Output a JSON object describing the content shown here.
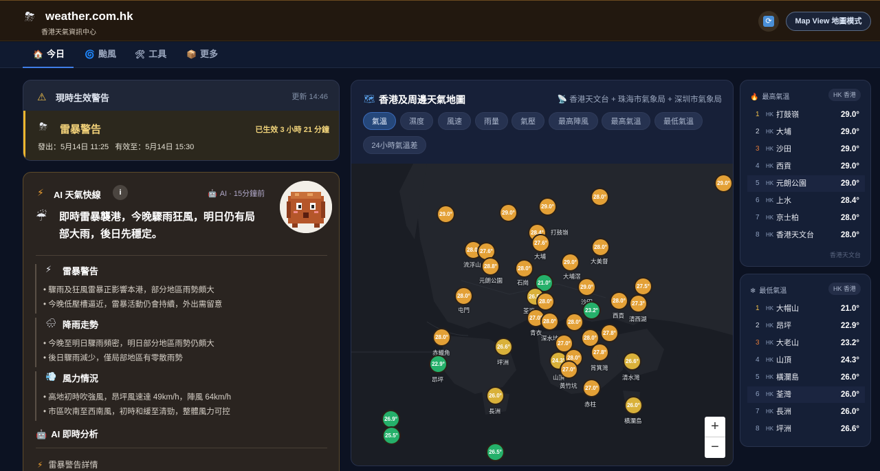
{
  "header": {
    "logo_icon": "⛈",
    "title": "weather.com.hk",
    "subtitle": "香港天氣資訊中心",
    "refresh_icon": "⟳",
    "map_view_label": "Map View 地圖模式"
  },
  "nav": {
    "tabs": [
      {
        "icon": "🏠",
        "label": "今日",
        "active": true
      },
      {
        "icon": "🌀",
        "label": "颱風",
        "active": false
      },
      {
        "icon": "🛠",
        "label": "工具",
        "active": false
      },
      {
        "icon": "📦",
        "label": "更多",
        "active": false
      }
    ]
  },
  "warnings": {
    "icon": "⚠",
    "title": "現時生效警告",
    "updated": "更新 14:46",
    "item": {
      "icon": "⛈",
      "title": "雷暴警告",
      "elapsed": "已生效 3 小時 21 分鐘",
      "issued": "發出：5月14日 11:25",
      "valid_until": "有效至：5月14日 15:30"
    }
  },
  "ai": {
    "icon": "⚡",
    "title": "AI 天氣快線",
    "info_icon": "i",
    "meta_icon": "🤖",
    "meta": "AI · 15分鐘前",
    "headline_icon": "☔",
    "headline": "即時雷暴襲港，今晚驟雨狂風，明日仍有局部大雨，後日先穩定。",
    "sections": [
      {
        "icon": "⚡",
        "title": "雷暴警告",
        "lines": [
          "• 驟雨及狂風雷暴正影響本港，部分地區雨勢頗大",
          "• 今晚低壓槽逼近，雷暴活動仍會持續，外出需留意"
        ]
      },
      {
        "icon": "🌧",
        "title": "降雨走勢",
        "lines": [
          "• 今晚至明日驟雨頻密，明日部分地區雨勢仍頗大",
          "• 後日驟雨減少，僅局部地區有零散雨勢"
        ]
      },
      {
        "icon": "💨",
        "title": "風力情況",
        "lines": [
          "• 高地初時吹強風，昂坪風速達 49km/h，陣風 64km/h",
          "• 市區吹南至西南風，初時和緩至清勁，整體風力可控"
        ]
      }
    ],
    "now_icon": "🤖",
    "now_title": "AI 即時分析",
    "detail_icon": "⚡",
    "detail_title": "雷暴警告詳情"
  },
  "map": {
    "title_icon": "🗺",
    "title": "香港及周邊天氣地圖",
    "sources_icon": "📡",
    "sources": "香港天文台 + 珠海市氣象局 + 深圳市氣象局",
    "chips": [
      "氣溫",
      "濕度",
      "風速",
      "雨量",
      "氣壓",
      "最高陣風",
      "最高氣溫",
      "最低氣溫",
      "24小時氣溫差"
    ],
    "active_chip": "氣溫",
    "zoom_in": "+",
    "zoom_out": "−",
    "markers": [
      {
        "label": "29.0°",
        "color": "or"
      },
      {
        "label": "29.0°",
        "color": "or"
      },
      {
        "label": "29.0°",
        "color": "or"
      },
      {
        "label": "29.0°",
        "color": "or"
      },
      {
        "label": "28.0°",
        "color": "or"
      },
      {
        "label": "28.4°",
        "color": "or"
      },
      {
        "label": "27.6°",
        "color": "or"
      },
      {
        "label": "28.0°",
        "color": "or"
      },
      {
        "label": "27.6°",
        "color": "or"
      },
      {
        "label": "28.8°",
        "color": "or"
      },
      {
        "label": "28.0°",
        "color": "or"
      },
      {
        "label": "29.0°",
        "color": "or"
      },
      {
        "label": "28.0°",
        "color": "or"
      },
      {
        "label": "21.0°",
        "color": "gr"
      },
      {
        "label": "29.0°",
        "color": "or"
      },
      {
        "label": "27.5°",
        "color": "or"
      },
      {
        "label": "28.0°",
        "color": "or"
      },
      {
        "label": "26.5°",
        "color": "yl"
      },
      {
        "label": "28.0°",
        "color": "or"
      },
      {
        "label": "23.2°",
        "color": "gr"
      },
      {
        "label": "28.0°",
        "color": "or"
      },
      {
        "label": "27.3°",
        "color": "or"
      },
      {
        "label": "27.0°",
        "color": "or"
      },
      {
        "label": "28.0°",
        "color": "or"
      },
      {
        "label": "28.0°",
        "color": "or"
      },
      {
        "label": "27.8°",
        "color": "or"
      },
      {
        "label": "28.0°",
        "color": "or"
      },
      {
        "label": "28.0°",
        "color": "or"
      },
      {
        "label": "26.6°",
        "color": "yl"
      },
      {
        "label": "22.9°",
        "color": "gr"
      },
      {
        "label": "27.8°",
        "color": "or"
      },
      {
        "label": "24.3°",
        "color": "yl"
      },
      {
        "label": "28.0°",
        "color": "or"
      },
      {
        "label": "27.0°",
        "color": "or"
      },
      {
        "label": "27.0°",
        "color": "or"
      },
      {
        "label": "26.6°",
        "color": "yl"
      },
      {
        "label": "27.0°",
        "color": "or"
      },
      {
        "label": "26.0°",
        "color": "yl"
      },
      {
        "label": "26.0°",
        "color": "yl"
      },
      {
        "label": "26.9°",
        "color": "gr"
      },
      {
        "label": "25.5°",
        "color": "gr"
      },
      {
        "label": "26.5°",
        "color": "gr"
      }
    ],
    "places": [
      "打鼓嶺",
      "流浮山",
      "元朗公園",
      "大埔",
      "大美督",
      "石崗",
      "大埔滘",
      "沙田",
      "西貢",
      "清西湖",
      "屯門",
      "荃灣",
      "青衣",
      "深水埗",
      "赤鱲角",
      "坪洲",
      "昂坪",
      "山頂",
      "黃竹坑",
      "筲箕灣",
      "清水灣",
      "赤柱",
      "長洲",
      "橫瀾島"
    ]
  },
  "rank_high": {
    "icon": "🔥",
    "title": "最高氣溫",
    "chip": "HK 香港",
    "rows": [
      {
        "rank": "1",
        "hk": "HK",
        "name": "打鼓嶺",
        "value": "29.0°"
      },
      {
        "rank": "2",
        "hk": "HK",
        "name": "大埔",
        "value": "29.0°"
      },
      {
        "rank": "3",
        "hk": "HK",
        "name": "沙田",
        "value": "29.0°"
      },
      {
        "rank": "4",
        "hk": "HK",
        "name": "西貢",
        "value": "29.0°"
      },
      {
        "rank": "5",
        "hk": "HK",
        "name": "元朗公園",
        "value": "29.0°"
      },
      {
        "rank": "6",
        "hk": "HK",
        "name": "上水",
        "value": "28.4°"
      },
      {
        "rank": "7",
        "hk": "HK",
        "name": "京士柏",
        "value": "28.0°"
      },
      {
        "rank": "8",
        "hk": "HK",
        "name": "香港天文台",
        "value": "28.0°"
      }
    ],
    "source": "香港天文台"
  },
  "rank_low": {
    "icon": "❄",
    "title": "最低氣溫",
    "chip": "HK 香港",
    "rows": [
      {
        "rank": "1",
        "hk": "HK",
        "name": "大帽山",
        "value": "21.0°"
      },
      {
        "rank": "2",
        "hk": "HK",
        "name": "昂坪",
        "value": "22.9°"
      },
      {
        "rank": "3",
        "hk": "HK",
        "name": "大老山",
        "value": "23.2°"
      },
      {
        "rank": "4",
        "hk": "HK",
        "name": "山頂",
        "value": "24.3°"
      },
      {
        "rank": "5",
        "hk": "HK",
        "name": "橫瀾島",
        "value": "26.0°"
      },
      {
        "rank": "6",
        "hk": "HK",
        "name": "荃灣",
        "value": "26.0°"
      },
      {
        "rank": "7",
        "hk": "HK",
        "name": "長洲",
        "value": "26.0°"
      },
      {
        "rank": "8",
        "hk": "HK",
        "name": "坪洲",
        "value": "26.6°"
      }
    ]
  }
}
